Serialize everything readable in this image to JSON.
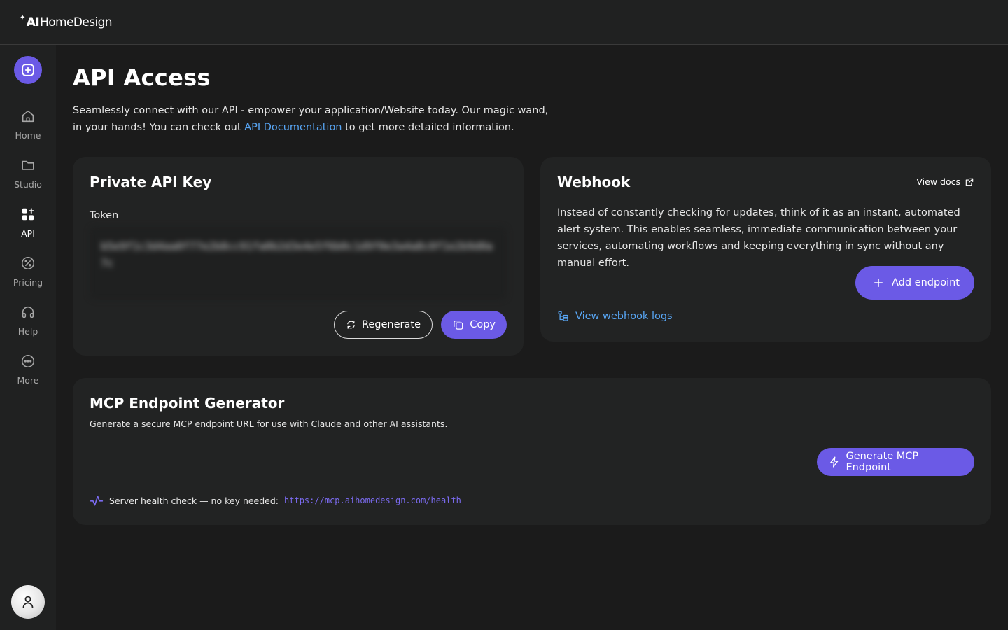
{
  "brand": {
    "ai": "AI",
    "name": "HomeDesign"
  },
  "sidebar": {
    "items": [
      {
        "label": "Home",
        "icon": "home-icon"
      },
      {
        "label": "Studio",
        "icon": "folder-icon"
      },
      {
        "label": "API",
        "icon": "grid-plus-icon",
        "active": true
      },
      {
        "label": "Pricing",
        "icon": "percent-icon"
      },
      {
        "label": "Help",
        "icon": "headphones-icon"
      },
      {
        "label": "More",
        "icon": "more-icon"
      }
    ]
  },
  "page": {
    "title": "API Access",
    "intro_before": "Seamlessly connect with our API - empower your application/Website today. Our magic wand, in your hands! You can check out ",
    "intro_link": "API Documentation",
    "intro_after": " to get more detailed information."
  },
  "api_key": {
    "title": "Private API Key",
    "token_label": "Token",
    "token_value": "b5e9f1c3d4aa0f77e2b8cc91fa0b2d3e4e5f6b0c1d9f0e3a4a8c0f1e2b9d0a7c",
    "regenerate_label": "Regenerate",
    "copy_label": "Copy"
  },
  "webhook": {
    "title": "Webhook",
    "view_docs": "View docs",
    "description": "Instead of constantly checking for updates, think of it as an instant, automated alert system. This enables seamless, immediate communication between your services, automating workflows and keeping everything in sync without any manual effort.",
    "add_endpoint": "Add endpoint",
    "view_logs": "View webhook logs"
  },
  "mcp": {
    "title": "MCP Endpoint Generator",
    "subtitle": "Generate a secure MCP endpoint URL for use with Claude and other AI assistants.",
    "generate_label": "Generate MCP Endpoint",
    "health_text": "Server health check — no key needed:",
    "health_url": "https://mcp.aihomedesign.com/health"
  },
  "colors": {
    "accent": "#6b5ae6",
    "link": "#58a6f5",
    "background": "#1b1b1b",
    "card": "#222323"
  }
}
